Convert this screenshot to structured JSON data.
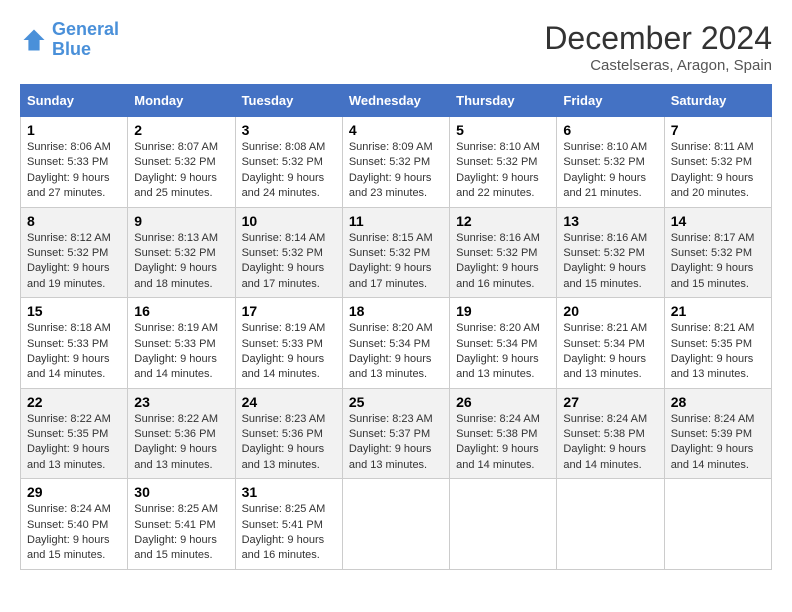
{
  "header": {
    "logo_general": "General",
    "logo_blue": "Blue",
    "month_title": "December 2024",
    "location": "Castelseras, Aragon, Spain"
  },
  "weekdays": [
    "Sunday",
    "Monday",
    "Tuesday",
    "Wednesday",
    "Thursday",
    "Friday",
    "Saturday"
  ],
  "weeks": [
    [
      {
        "day": "1",
        "sunrise": "8:06 AM",
        "sunset": "5:33 PM",
        "daylight": "9 hours and 27 minutes."
      },
      {
        "day": "2",
        "sunrise": "8:07 AM",
        "sunset": "5:32 PM",
        "daylight": "9 hours and 25 minutes."
      },
      {
        "day": "3",
        "sunrise": "8:08 AM",
        "sunset": "5:32 PM",
        "daylight": "9 hours and 24 minutes."
      },
      {
        "day": "4",
        "sunrise": "8:09 AM",
        "sunset": "5:32 PM",
        "daylight": "9 hours and 23 minutes."
      },
      {
        "day": "5",
        "sunrise": "8:10 AM",
        "sunset": "5:32 PM",
        "daylight": "9 hours and 22 minutes."
      },
      {
        "day": "6",
        "sunrise": "8:10 AM",
        "sunset": "5:32 PM",
        "daylight": "9 hours and 21 minutes."
      },
      {
        "day": "7",
        "sunrise": "8:11 AM",
        "sunset": "5:32 PM",
        "daylight": "9 hours and 20 minutes."
      }
    ],
    [
      {
        "day": "8",
        "sunrise": "8:12 AM",
        "sunset": "5:32 PM",
        "daylight": "9 hours and 19 minutes."
      },
      {
        "day": "9",
        "sunrise": "8:13 AM",
        "sunset": "5:32 PM",
        "daylight": "9 hours and 18 minutes."
      },
      {
        "day": "10",
        "sunrise": "8:14 AM",
        "sunset": "5:32 PM",
        "daylight": "9 hours and 17 minutes."
      },
      {
        "day": "11",
        "sunrise": "8:15 AM",
        "sunset": "5:32 PM",
        "daylight": "9 hours and 17 minutes."
      },
      {
        "day": "12",
        "sunrise": "8:16 AM",
        "sunset": "5:32 PM",
        "daylight": "9 hours and 16 minutes."
      },
      {
        "day": "13",
        "sunrise": "8:16 AM",
        "sunset": "5:32 PM",
        "daylight": "9 hours and 15 minutes."
      },
      {
        "day": "14",
        "sunrise": "8:17 AM",
        "sunset": "5:32 PM",
        "daylight": "9 hours and 15 minutes."
      }
    ],
    [
      {
        "day": "15",
        "sunrise": "8:18 AM",
        "sunset": "5:33 PM",
        "daylight": "9 hours and 14 minutes."
      },
      {
        "day": "16",
        "sunrise": "8:19 AM",
        "sunset": "5:33 PM",
        "daylight": "9 hours and 14 minutes."
      },
      {
        "day": "17",
        "sunrise": "8:19 AM",
        "sunset": "5:33 PM",
        "daylight": "9 hours and 14 minutes."
      },
      {
        "day": "18",
        "sunrise": "8:20 AM",
        "sunset": "5:34 PM",
        "daylight": "9 hours and 13 minutes."
      },
      {
        "day": "19",
        "sunrise": "8:20 AM",
        "sunset": "5:34 PM",
        "daylight": "9 hours and 13 minutes."
      },
      {
        "day": "20",
        "sunrise": "8:21 AM",
        "sunset": "5:34 PM",
        "daylight": "9 hours and 13 minutes."
      },
      {
        "day": "21",
        "sunrise": "8:21 AM",
        "sunset": "5:35 PM",
        "daylight": "9 hours and 13 minutes."
      }
    ],
    [
      {
        "day": "22",
        "sunrise": "8:22 AM",
        "sunset": "5:35 PM",
        "daylight": "9 hours and 13 minutes."
      },
      {
        "day": "23",
        "sunrise": "8:22 AM",
        "sunset": "5:36 PM",
        "daylight": "9 hours and 13 minutes."
      },
      {
        "day": "24",
        "sunrise": "8:23 AM",
        "sunset": "5:36 PM",
        "daylight": "9 hours and 13 minutes."
      },
      {
        "day": "25",
        "sunrise": "8:23 AM",
        "sunset": "5:37 PM",
        "daylight": "9 hours and 13 minutes."
      },
      {
        "day": "26",
        "sunrise": "8:24 AM",
        "sunset": "5:38 PM",
        "daylight": "9 hours and 14 minutes."
      },
      {
        "day": "27",
        "sunrise": "8:24 AM",
        "sunset": "5:38 PM",
        "daylight": "9 hours and 14 minutes."
      },
      {
        "day": "28",
        "sunrise": "8:24 AM",
        "sunset": "5:39 PM",
        "daylight": "9 hours and 14 minutes."
      }
    ],
    [
      {
        "day": "29",
        "sunrise": "8:24 AM",
        "sunset": "5:40 PM",
        "daylight": "9 hours and 15 minutes."
      },
      {
        "day": "30",
        "sunrise": "8:25 AM",
        "sunset": "5:41 PM",
        "daylight": "9 hours and 15 minutes."
      },
      {
        "day": "31",
        "sunrise": "8:25 AM",
        "sunset": "5:41 PM",
        "daylight": "9 hours and 16 minutes."
      },
      null,
      null,
      null,
      null
    ]
  ]
}
